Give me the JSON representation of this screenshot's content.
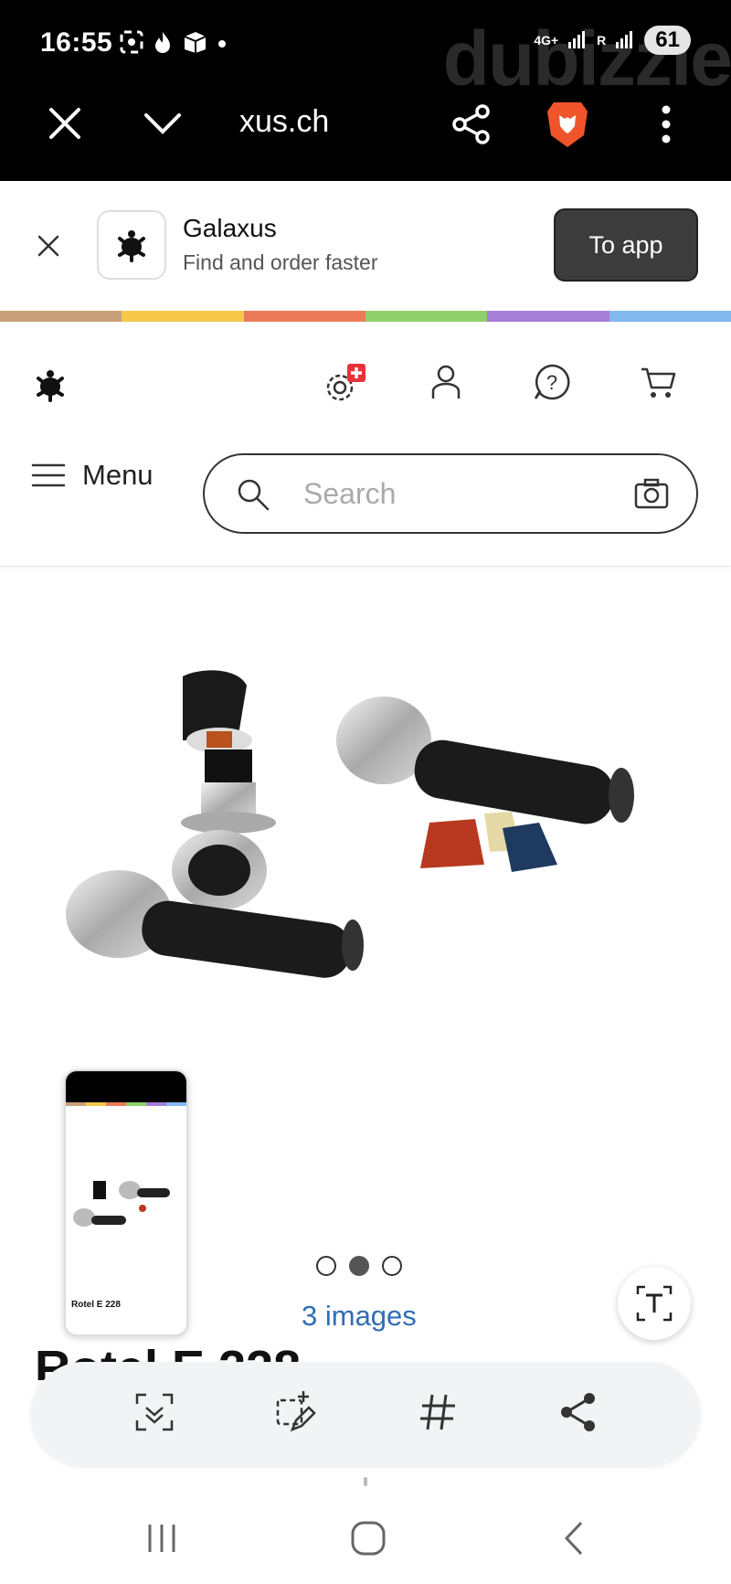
{
  "status_bar": {
    "time": "16:55",
    "network": "4G+",
    "sim": "R",
    "battery": "61",
    "watermark": "dubizzle"
  },
  "browser": {
    "url": "xus.ch"
  },
  "promo": {
    "app_name": "Galaxus",
    "tagline": "Find and order faster",
    "button_label": "To app"
  },
  "header": {
    "menu_label": "Menu",
    "search_placeholder": "Search"
  },
  "rainbow_colors": [
    "#c8a079",
    "#f5c84a",
    "#ec7a5a",
    "#8fd06b",
    "#a57ed6",
    "#83b9ee"
  ],
  "product": {
    "images_link": "3 images",
    "image_count": 3,
    "active_image": 2,
    "title": "Rotel E 228",
    "thumbnail_title": "Rotel E 228"
  },
  "colors": {
    "link": "#2f6db5",
    "promo_button": "#3c3c3c",
    "badge_red": "#e63238"
  }
}
